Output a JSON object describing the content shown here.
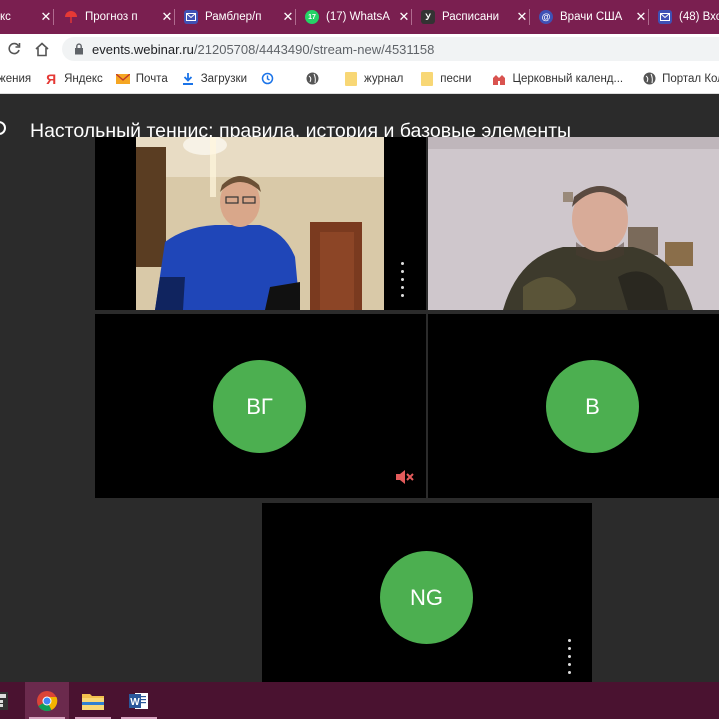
{
  "tabs": [
    {
      "title": "кс",
      "icon": "window-icon",
      "color": "#7a1f50"
    },
    {
      "title": "Прогноз п",
      "icon": "umbrella-icon",
      "color": "#e53935"
    },
    {
      "title": "Рамблер/п",
      "icon": "mail-icon",
      "color": "#3f51b5"
    },
    {
      "title": "(17) WhatsA",
      "icon": "whatsapp-icon",
      "color": "#25d366",
      "badge": "17"
    },
    {
      "title": "Расписани",
      "icon": "u-icon",
      "color": "#333333",
      "badge": "У"
    },
    {
      "title": "Врачи США",
      "icon": "at-icon",
      "color": "#3f51b5",
      "badge": "@"
    },
    {
      "title": "(48) Вхо",
      "icon": "mail-icon",
      "color": "#3f51b5"
    }
  ],
  "address": {
    "host": "events.webinar.ru",
    "path": "/21205708/4443490/stream-new/4531158"
  },
  "bookmarks": [
    {
      "label": "жения",
      "icon": "none"
    },
    {
      "label": "Яндекс",
      "icon": "yandex-icon"
    },
    {
      "label": "Почта",
      "icon": "mail-icon"
    },
    {
      "label": "Загрузки",
      "icon": "download-icon"
    },
    {
      "label": "",
      "icon": "history-icon"
    },
    {
      "label": "",
      "icon": "globe-icon"
    },
    {
      "label": "журнал",
      "icon": "folder-icon"
    },
    {
      "label": "песни",
      "icon": "folder-icon"
    },
    {
      "label": "Церковный календ...",
      "icon": "church-icon"
    },
    {
      "label": "Портал Кол",
      "icon": "globe-icon"
    }
  ],
  "webinar": {
    "title": "Настольный теннис: правила, история и базовые элементы",
    "participants": [
      {
        "name": "video-1",
        "type": "video"
      },
      {
        "name": "video-2",
        "type": "video"
      },
      {
        "initials": "ВГ",
        "type": "avatar",
        "muted": true
      },
      {
        "initials": "В",
        "type": "avatar",
        "muted": false
      },
      {
        "initials": "NG",
        "type": "avatar",
        "muted": false
      }
    ]
  },
  "taskbar": {
    "items": [
      "calculator-icon",
      "chrome-icon",
      "file-explorer-icon",
      "word-icon"
    ]
  },
  "colors": {
    "accent": "#7a1f50",
    "avatar_green": "#4caf50",
    "muted_red": "#e35b5b",
    "stage_bg": "#2b2b2b"
  }
}
